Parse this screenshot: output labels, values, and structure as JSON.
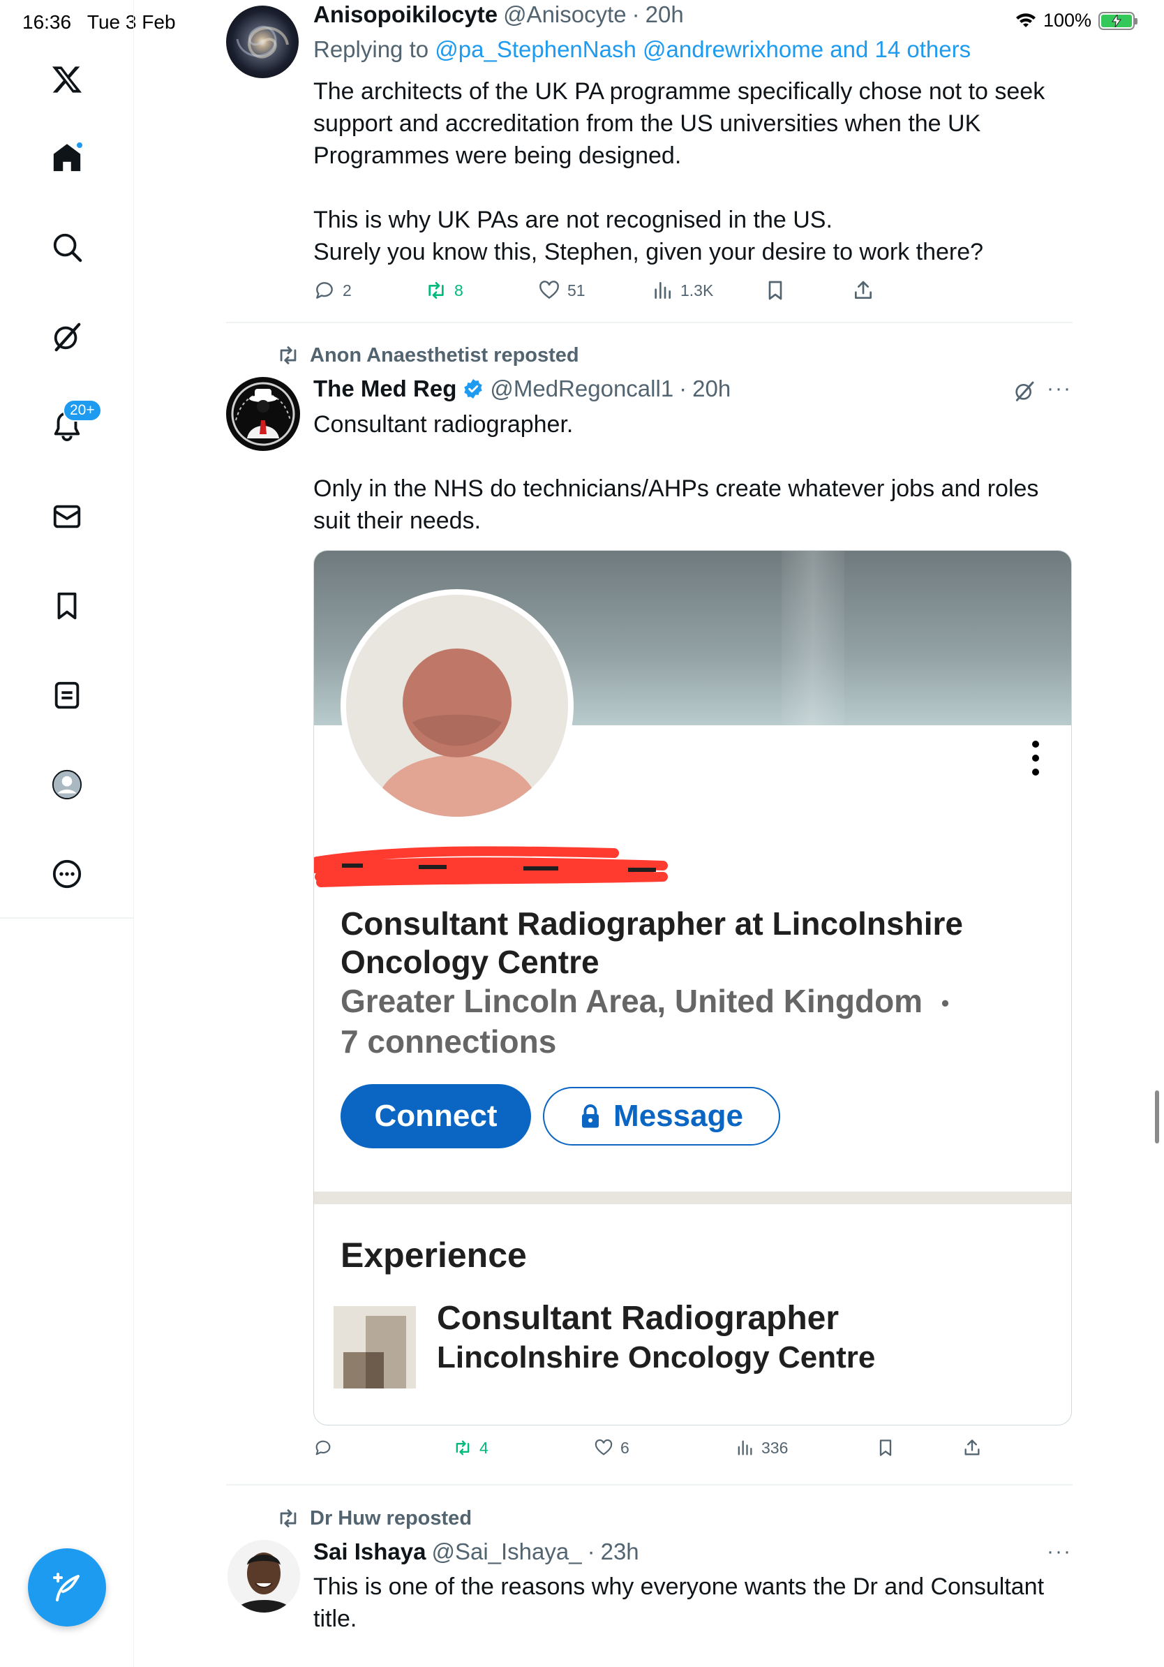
{
  "status_bar": {
    "time": "16:36",
    "date": "Tue 3 Feb",
    "battery": "100%"
  },
  "nav": {
    "items": [
      "x-logo-icon",
      "home-icon",
      "search-icon",
      "grok-icon",
      "notifications-icon",
      "messages-icon",
      "bookmarks-icon",
      "lists-icon",
      "profile-icon",
      "more-icon"
    ],
    "notifications_badge": "20+",
    "compose_icon": "compose-icon"
  },
  "tweets": [
    {
      "display_name": "Anisopoikilocyte",
      "handle": "@Anisocyte",
      "time": "20h",
      "replying_to_label": "Replying to",
      "replying_to": "@pa_StephenNash @andrewrixhome and 14 others",
      "text_lines": [
        "The architects of the UK PA programme specifically chose not to seek support and accreditation from the US universities when the UK Programmes were being designed.",
        "This is why UK PAs are not recognised in the US.",
        "Surely you know this, Stephen, given your desire to work there?"
      ],
      "replies": "2",
      "reposts": "8",
      "likes": "51",
      "views": "1.3K"
    },
    {
      "reposted_by": "Anon Anaesthetist reposted",
      "display_name": "The Med Reg",
      "handle": "@MedRegoncall1",
      "time": "20h",
      "verified": true,
      "text_lines": [
        "Consultant radiographer.",
        "Only in the NHS do technicians/AHPs create whatever jobs and roles suit their needs."
      ],
      "card": {
        "headline": "Consultant Radiographer at Lincolnshire Oncology Centre",
        "location": "Greater Lincoln Area, United Kingdom",
        "separator": "•",
        "connections": "7 connections",
        "connect_label": "Connect",
        "message_label": "Message",
        "experience_title": "Experience",
        "experience_role": "Consultant Radiographer",
        "experience_company": "Lincolnshire Oncology Centre"
      },
      "replies": "",
      "reposts": "4",
      "likes": "6",
      "views": "336"
    },
    {
      "reposted_by": "Dr Huw reposted",
      "display_name": "Sai Ishaya",
      "handle": "@Sai_Ishaya_",
      "time": "23h",
      "text_lines": [
        "This is one of the reasons why everyone wants the Dr and Consultant title."
      ]
    }
  ],
  "colors": {
    "accent": "#1d9bf0",
    "repost_green": "#00ba7c",
    "linkedin_blue": "#0a66c2",
    "muted": "#536471",
    "redaction_red": "#ff3b30"
  }
}
